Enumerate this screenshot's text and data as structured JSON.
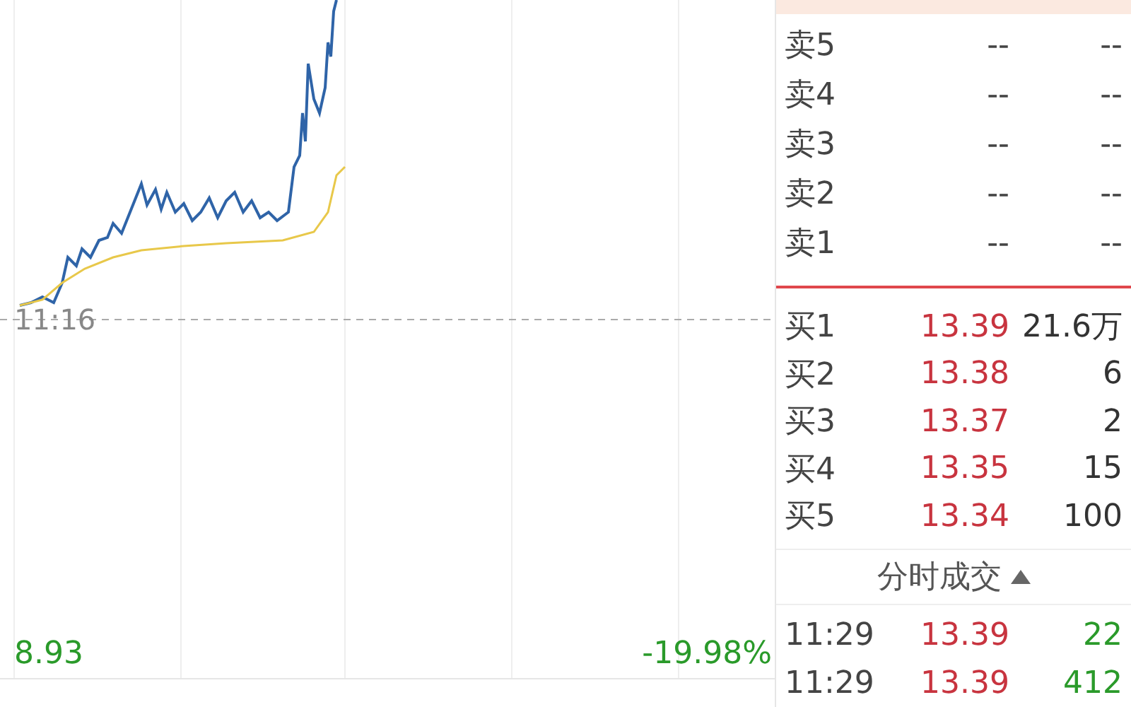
{
  "chart": {
    "time_label": "11:16",
    "low_price": "8.93",
    "low_change": "-19.98%"
  },
  "order_book": {
    "asks": [
      {
        "label": "卖5",
        "price": "--",
        "volume": "--"
      },
      {
        "label": "卖4",
        "price": "--",
        "volume": "--"
      },
      {
        "label": "卖3",
        "price": "--",
        "volume": "--"
      },
      {
        "label": "卖2",
        "price": "--",
        "volume": "--"
      },
      {
        "label": "卖1",
        "price": "--",
        "volume": "--"
      }
    ],
    "bids": [
      {
        "label": "买1",
        "price": "13.39",
        "volume": "21.6万"
      },
      {
        "label": "买2",
        "price": "13.38",
        "volume": "6"
      },
      {
        "label": "买3",
        "price": "13.37",
        "volume": "2"
      },
      {
        "label": "买4",
        "price": "13.35",
        "volume": "15"
      },
      {
        "label": "买5",
        "price": "13.34",
        "volume": "100"
      }
    ]
  },
  "trades": {
    "title": "分时成交",
    "rows": [
      {
        "time": "11:29",
        "price": "13.39",
        "volume": "22"
      },
      {
        "time": "11:29",
        "price": "13.39",
        "volume": "412"
      }
    ]
  }
}
